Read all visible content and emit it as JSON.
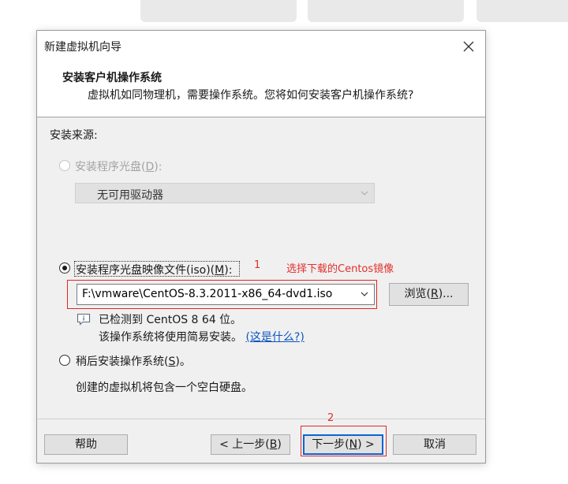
{
  "dialog": {
    "title": "新建虚拟机向导",
    "header_title": "安装客户机操作系统",
    "header_desc": "虚拟机如同物理机，需要操作系统。您将如何安装客户机操作系统?"
  },
  "install_source": {
    "label": "安装来源:",
    "disc": {
      "label_prefix": "安装程序光盘(",
      "label_key": "D",
      "label_suffix": "):",
      "dropdown_value": "无可用驱动器",
      "enabled": false
    },
    "iso": {
      "label_prefix": "安装程序光盘映像文件(iso)(",
      "label_key": "M",
      "label_suffix": "):",
      "selected": true,
      "path": "F:\\vmware\\CentOS-8.3.2011-x86_64-dvd1.iso",
      "browse_prefix": "浏览(",
      "browse_key": "R",
      "browse_suffix": ")...",
      "detected": "已检测到 CentOS 8 64 位。",
      "easy_install": "该操作系统将使用简易安装。",
      "whats_this": "(这是什么?)"
    },
    "later": {
      "label_prefix": "稍后安装操作系统(",
      "label_key": "S",
      "label_suffix": ")。",
      "selected": false,
      "note": "创建的虚拟机将包含一个空白硬盘。"
    }
  },
  "annotations": {
    "num1": "1",
    "text1": "选择下载的Centos镜像",
    "num2": "2",
    "color": "#e0302c"
  },
  "footer": {
    "help": "帮助",
    "back_prefix": "< 上一步(",
    "back_key": "B",
    "back_suffix": ")",
    "next_prefix": "下一步(",
    "next_key": "N",
    "next_suffix": ") >",
    "cancel": "取消"
  }
}
